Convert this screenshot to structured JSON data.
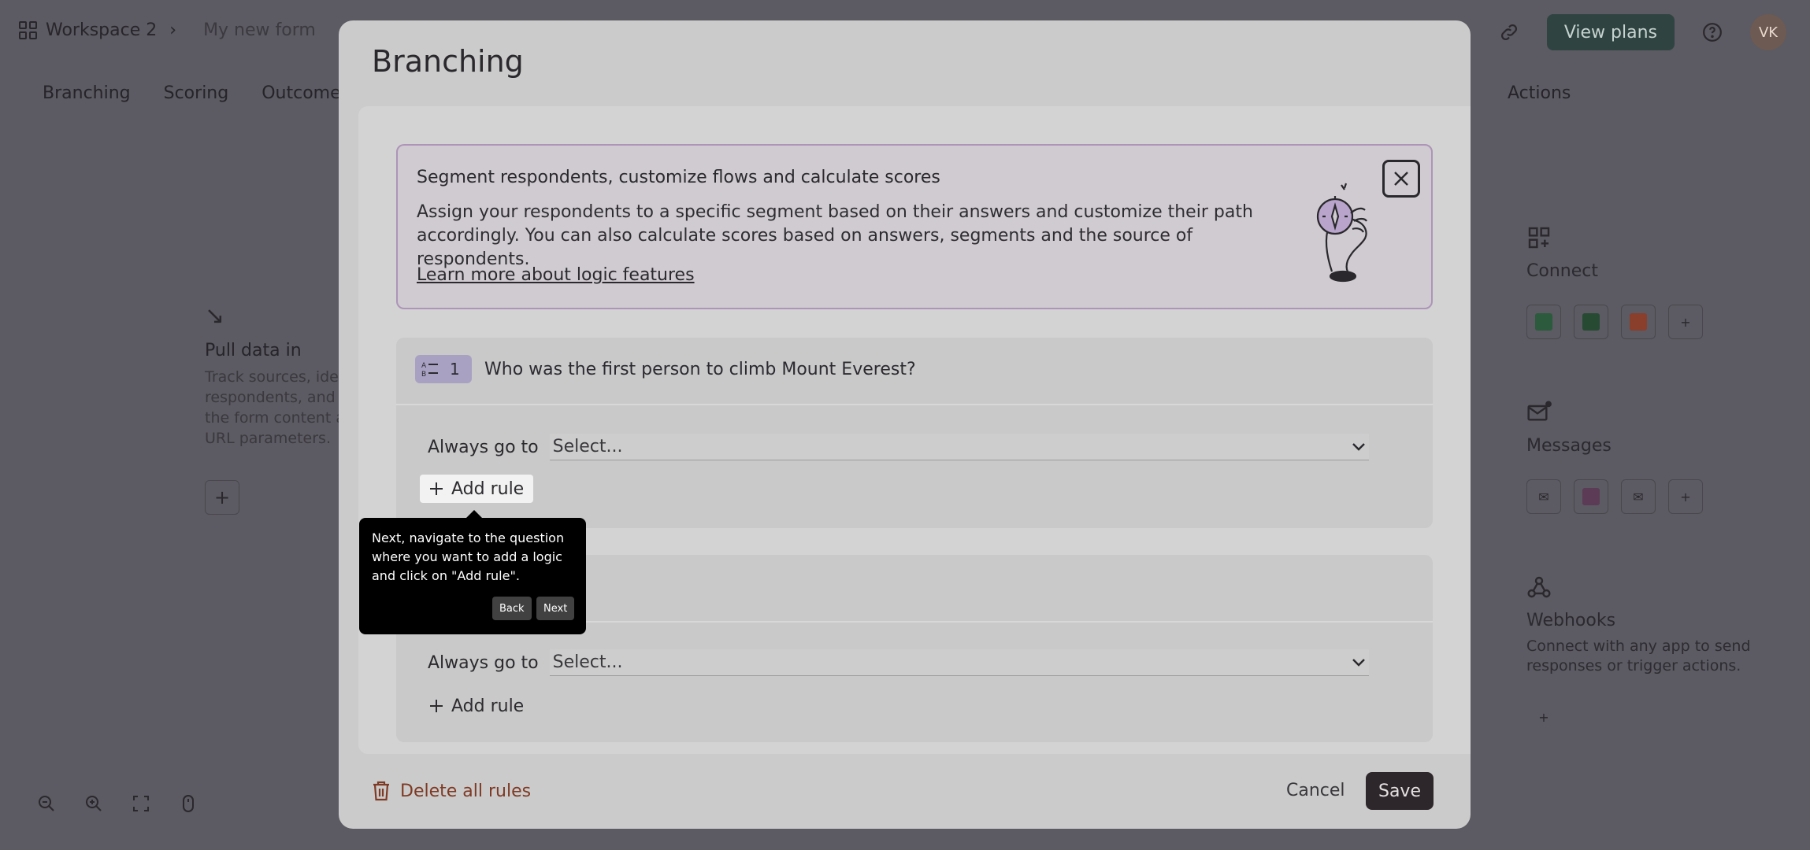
{
  "background": {
    "breadcrumb": {
      "workspace": "Workspace 2",
      "separator": "›",
      "form": "My new form"
    },
    "header": {
      "view_plans": "View plans",
      "avatar_initials": "VK"
    },
    "tabs": [
      "Branching",
      "Scoring",
      "Outcome qu"
    ],
    "actions_tab": "Actions",
    "pull_data": {
      "title": "Pull data in",
      "desc": "Track sources, ider respondents, and p the form content a URL parameters."
    },
    "connect": {
      "title": "Connect"
    },
    "messages": {
      "title": "Messages"
    },
    "webhooks": {
      "title": "Webhooks",
      "desc": "Connect with any app to send responses or trigger actions."
    }
  },
  "modal": {
    "title": "Branching",
    "banner": {
      "heading": "Segment respondents, customize flows and calculate scores",
      "body": "Assign your respondents to a specific segment based on their answers and customize their path accordingly. You can also calculate scores based on answers, segments and the source of respondents.",
      "link": "Learn more about logic features"
    },
    "questions": [
      {
        "number": "1",
        "text": "Who was the first person to climb Mount Everest?",
        "always_label": "Always go to",
        "select": "Select...",
        "add_rule": "Add rule"
      },
      {
        "number": "",
        "text": "",
        "always_label": "Always go to",
        "select": "Select...",
        "add_rule": "Add rule"
      }
    ],
    "footer": {
      "delete": "Delete all rules",
      "cancel": "Cancel",
      "save": "Save"
    }
  },
  "tooltip": {
    "text": "Next, navigate to the question where you want to add a logic and click on \"Add rule\".",
    "back": "Back",
    "next": "Next"
  }
}
